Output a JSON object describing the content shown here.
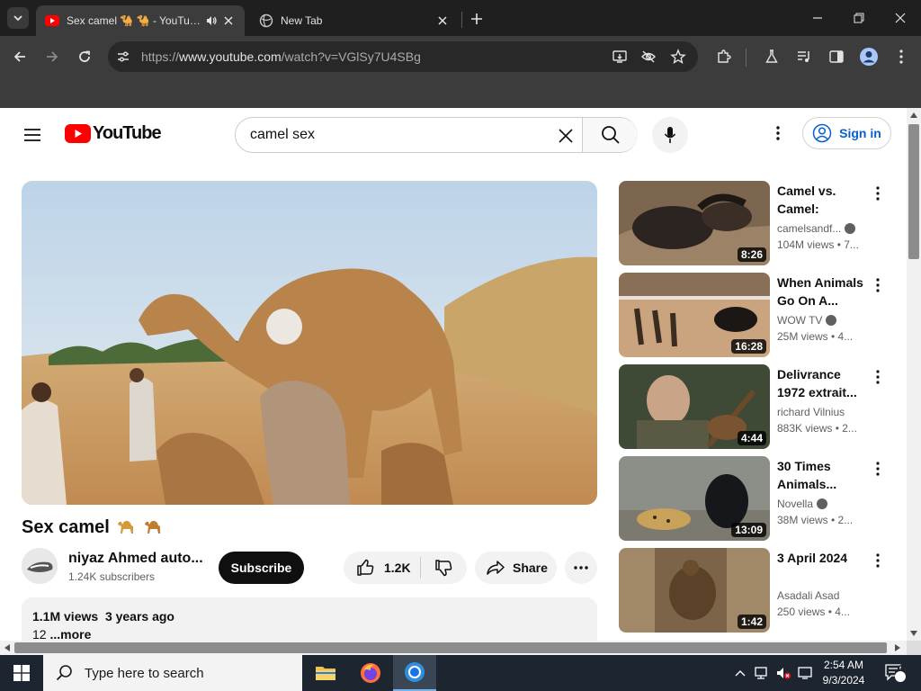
{
  "browser": {
    "tabs": [
      {
        "title": "Sex camel 🐪 🐪 - YouTube",
        "active": true,
        "audio": true
      },
      {
        "title": "New Tab",
        "active": false
      }
    ],
    "address": {
      "prefix": "https://",
      "domain": "www.youtube.com",
      "path": "/watch?v=VGlSy7U4SBg"
    }
  },
  "youtube": {
    "logo_text": "YouTube",
    "search": {
      "value": "camel sex"
    },
    "signin_label": "Sign in",
    "video": {
      "title": "Sex camel",
      "channel": "niyaz Ahmed auto...",
      "subscribers": "1.24K subscribers",
      "subscribe_label": "Subscribe",
      "likes": "1.2K",
      "share_label": "Share",
      "views": "1.1M views",
      "age": "3 years ago",
      "desc_line": "12",
      "more_label": "...more"
    },
    "recommendations": [
      {
        "title": "Camel vs. Camel: Anima...",
        "channel": "camelsandf...",
        "verified": true,
        "meta": "104M views • 7...",
        "duration": "8:26"
      },
      {
        "title": "When Animals Go On A...",
        "channel": "WOW TV",
        "verified": true,
        "meta": "25M views • 4...",
        "duration": "16:28"
      },
      {
        "title": "Delivrance 1972 extrait...",
        "channel": "richard Vilnius",
        "verified": false,
        "meta": "883K views • 2...",
        "duration": "4:44"
      },
      {
        "title": "30 Times Animals...",
        "channel": "Novella",
        "verified": true,
        "meta": "38M views • 2...",
        "duration": "13:09"
      },
      {
        "title": "3 April 2024",
        "channel": "Asadali Asad",
        "verified": false,
        "meta": "250 views • 4...",
        "duration": "1:42"
      }
    ]
  },
  "taskbar": {
    "search_placeholder": "Type here to search",
    "time": "2:54 AM",
    "date": "9/3/2024",
    "notifications": "2"
  },
  "colors": {
    "yt_red": "#ff0000",
    "link_blue": "#065fd4",
    "chrome_dark": "#1f1f1f",
    "taskbar": "#1c2530"
  }
}
